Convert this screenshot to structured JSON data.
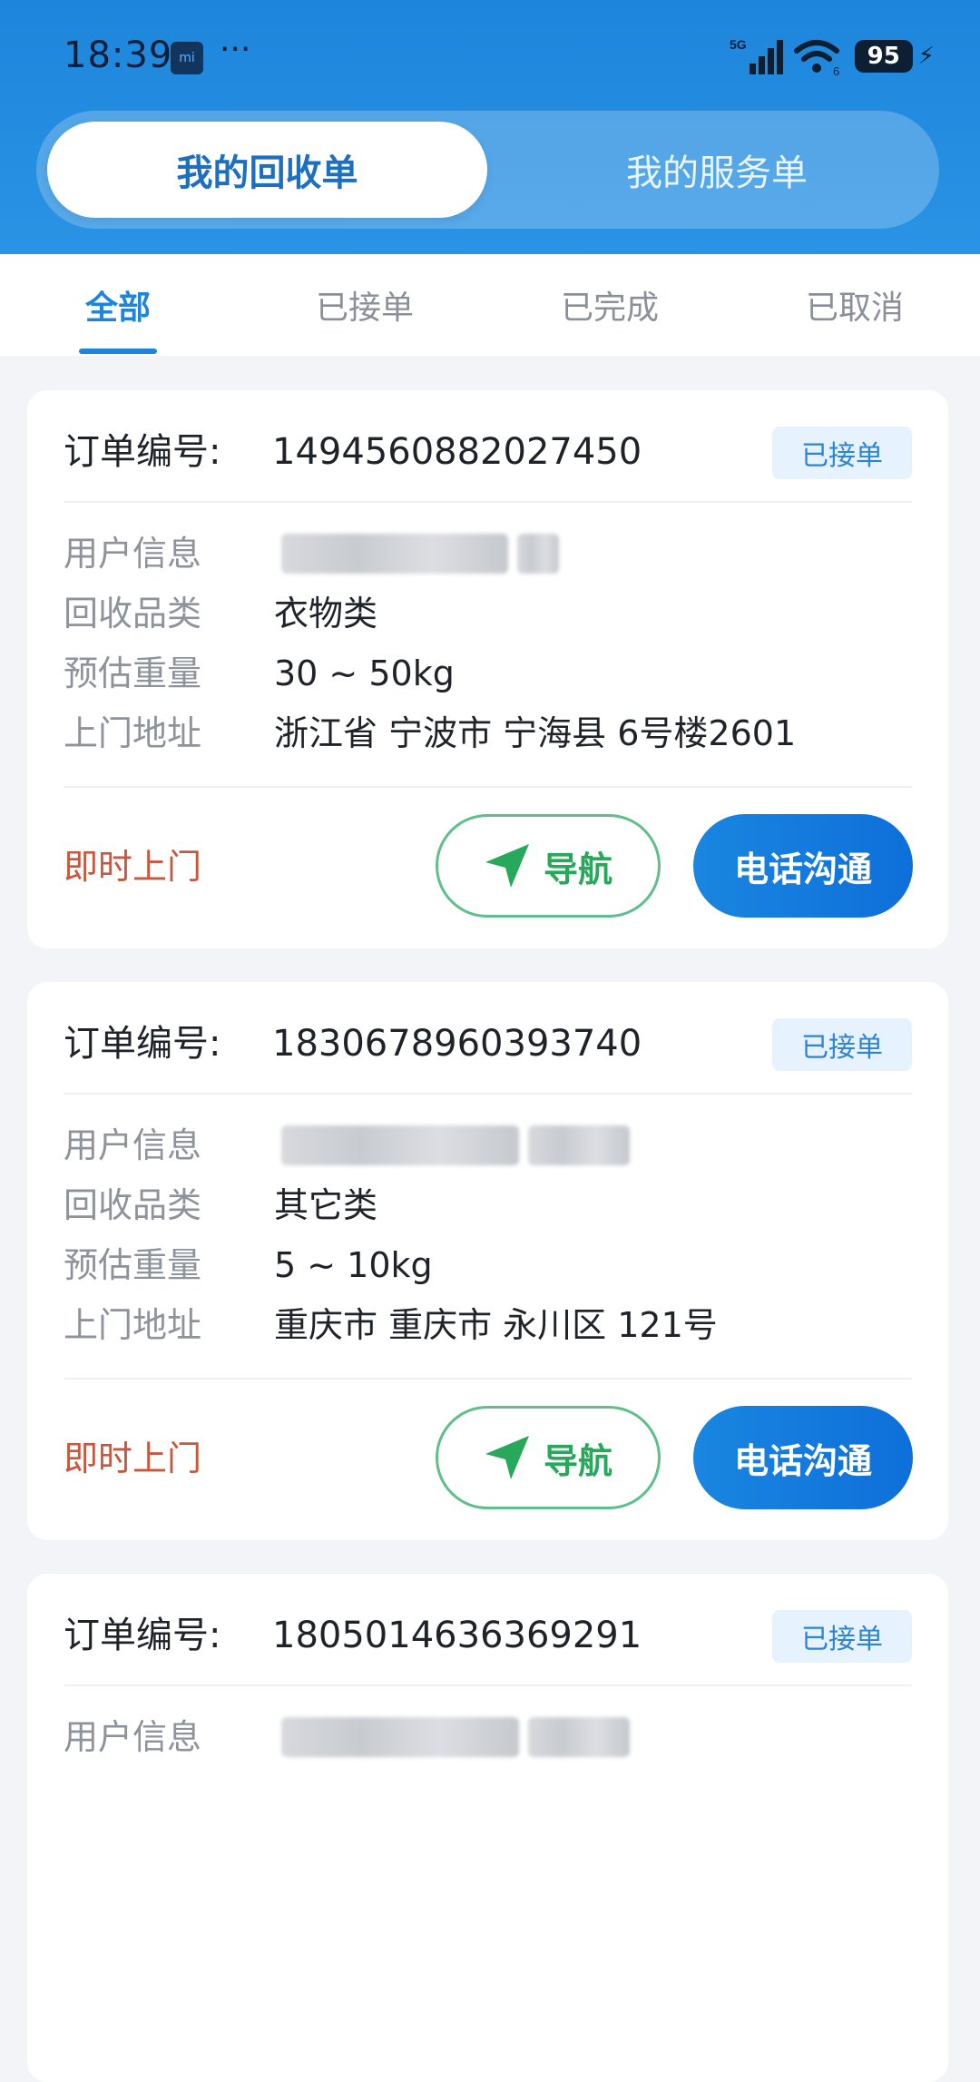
{
  "status_bar": {
    "time": "18:39",
    "app_icon_text": "mi",
    "dots": "···",
    "network": "5G",
    "wifi_sub": "6",
    "battery": "95"
  },
  "switch": {
    "active_label": "我的回收单",
    "inactive_label": "我的服务单"
  },
  "tabs": [
    {
      "label": "全部",
      "active": true
    },
    {
      "label": "已接单",
      "active": false
    },
    {
      "label": "已完成",
      "active": false
    },
    {
      "label": "已取消",
      "active": false
    }
  ],
  "labels": {
    "order_no": "订单编号:",
    "user_info": "用户信息",
    "category": "回收品类",
    "weight": "预估重量",
    "address": "上门地址",
    "navigate": "导航",
    "call": "电话沟通"
  },
  "colors": {
    "primary": "#1d86dc",
    "badge_bg": "#e6f2fd",
    "mode_text": "#c7573d",
    "nav_green": "#27a85a"
  },
  "orders": [
    {
      "order_no": "1494560882027450",
      "status": "已接单",
      "category": "衣物类",
      "weight": "30 ~ 50kg",
      "address": "浙江省 宁波市 宁海县 6号楼2601",
      "mode": "即时上门"
    },
    {
      "order_no": "1830678960393740",
      "status": "已接单",
      "category": "其它类",
      "weight": "5 ~ 10kg",
      "address": "重庆市 重庆市 永川区 121号",
      "mode": "即时上门"
    },
    {
      "order_no": "1805014636369291",
      "status": "已接单"
    }
  ]
}
